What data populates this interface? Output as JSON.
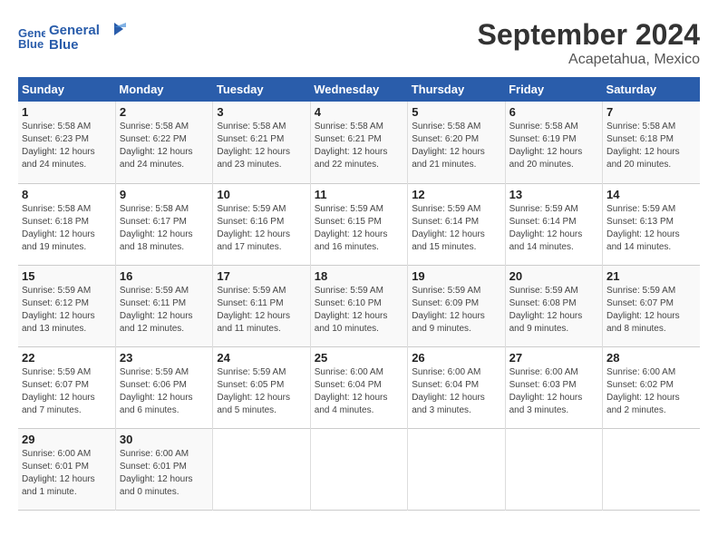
{
  "header": {
    "logo_line1": "General",
    "logo_line2": "Blue",
    "month": "September 2024",
    "location": "Acapetahua, Mexico"
  },
  "days_of_week": [
    "Sunday",
    "Monday",
    "Tuesday",
    "Wednesday",
    "Thursday",
    "Friday",
    "Saturday"
  ],
  "weeks": [
    [
      {
        "day": "1",
        "info": "Sunrise: 5:58 AM\nSunset: 6:23 PM\nDaylight: 12 hours\nand 24 minutes."
      },
      {
        "day": "2",
        "info": "Sunrise: 5:58 AM\nSunset: 6:22 PM\nDaylight: 12 hours\nand 24 minutes."
      },
      {
        "day": "3",
        "info": "Sunrise: 5:58 AM\nSunset: 6:21 PM\nDaylight: 12 hours\nand 23 minutes."
      },
      {
        "day": "4",
        "info": "Sunrise: 5:58 AM\nSunset: 6:21 PM\nDaylight: 12 hours\nand 22 minutes."
      },
      {
        "day": "5",
        "info": "Sunrise: 5:58 AM\nSunset: 6:20 PM\nDaylight: 12 hours\nand 21 minutes."
      },
      {
        "day": "6",
        "info": "Sunrise: 5:58 AM\nSunset: 6:19 PM\nDaylight: 12 hours\nand 20 minutes."
      },
      {
        "day": "7",
        "info": "Sunrise: 5:58 AM\nSunset: 6:18 PM\nDaylight: 12 hours\nand 20 minutes."
      }
    ],
    [
      {
        "day": "8",
        "info": "Sunrise: 5:58 AM\nSunset: 6:18 PM\nDaylight: 12 hours\nand 19 minutes."
      },
      {
        "day": "9",
        "info": "Sunrise: 5:58 AM\nSunset: 6:17 PM\nDaylight: 12 hours\nand 18 minutes."
      },
      {
        "day": "10",
        "info": "Sunrise: 5:59 AM\nSunset: 6:16 PM\nDaylight: 12 hours\nand 17 minutes."
      },
      {
        "day": "11",
        "info": "Sunrise: 5:59 AM\nSunset: 6:15 PM\nDaylight: 12 hours\nand 16 minutes."
      },
      {
        "day": "12",
        "info": "Sunrise: 5:59 AM\nSunset: 6:14 PM\nDaylight: 12 hours\nand 15 minutes."
      },
      {
        "day": "13",
        "info": "Sunrise: 5:59 AM\nSunset: 6:14 PM\nDaylight: 12 hours\nand 14 minutes."
      },
      {
        "day": "14",
        "info": "Sunrise: 5:59 AM\nSunset: 6:13 PM\nDaylight: 12 hours\nand 14 minutes."
      }
    ],
    [
      {
        "day": "15",
        "info": "Sunrise: 5:59 AM\nSunset: 6:12 PM\nDaylight: 12 hours\nand 13 minutes."
      },
      {
        "day": "16",
        "info": "Sunrise: 5:59 AM\nSunset: 6:11 PM\nDaylight: 12 hours\nand 12 minutes."
      },
      {
        "day": "17",
        "info": "Sunrise: 5:59 AM\nSunset: 6:11 PM\nDaylight: 12 hours\nand 11 minutes."
      },
      {
        "day": "18",
        "info": "Sunrise: 5:59 AM\nSunset: 6:10 PM\nDaylight: 12 hours\nand 10 minutes."
      },
      {
        "day": "19",
        "info": "Sunrise: 5:59 AM\nSunset: 6:09 PM\nDaylight: 12 hours\nand 9 minutes."
      },
      {
        "day": "20",
        "info": "Sunrise: 5:59 AM\nSunset: 6:08 PM\nDaylight: 12 hours\nand 9 minutes."
      },
      {
        "day": "21",
        "info": "Sunrise: 5:59 AM\nSunset: 6:07 PM\nDaylight: 12 hours\nand 8 minutes."
      }
    ],
    [
      {
        "day": "22",
        "info": "Sunrise: 5:59 AM\nSunset: 6:07 PM\nDaylight: 12 hours\nand 7 minutes."
      },
      {
        "day": "23",
        "info": "Sunrise: 5:59 AM\nSunset: 6:06 PM\nDaylight: 12 hours\nand 6 minutes."
      },
      {
        "day": "24",
        "info": "Sunrise: 5:59 AM\nSunset: 6:05 PM\nDaylight: 12 hours\nand 5 minutes."
      },
      {
        "day": "25",
        "info": "Sunrise: 6:00 AM\nSunset: 6:04 PM\nDaylight: 12 hours\nand 4 minutes."
      },
      {
        "day": "26",
        "info": "Sunrise: 6:00 AM\nSunset: 6:04 PM\nDaylight: 12 hours\nand 3 minutes."
      },
      {
        "day": "27",
        "info": "Sunrise: 6:00 AM\nSunset: 6:03 PM\nDaylight: 12 hours\nand 3 minutes."
      },
      {
        "day": "28",
        "info": "Sunrise: 6:00 AM\nSunset: 6:02 PM\nDaylight: 12 hours\nand 2 minutes."
      }
    ],
    [
      {
        "day": "29",
        "info": "Sunrise: 6:00 AM\nSunset: 6:01 PM\nDaylight: 12 hours\nand 1 minute."
      },
      {
        "day": "30",
        "info": "Sunrise: 6:00 AM\nSunset: 6:01 PM\nDaylight: 12 hours\nand 0 minutes."
      },
      null,
      null,
      null,
      null,
      null
    ]
  ]
}
